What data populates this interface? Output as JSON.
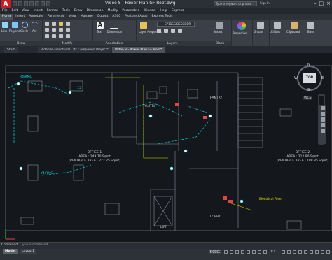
{
  "app": {
    "logo": "A",
    "title": "Video 8 - Power Plan GF Roof.dwg",
    "search_placeholder": "Type a keyword or phrase",
    "sign_in": "Sign In",
    "window_controls": [
      "–",
      "□",
      "×"
    ]
  },
  "menu": [
    "File",
    "Edit",
    "View",
    "Insert",
    "Format",
    "Tools",
    "Draw",
    "Dimension",
    "Modify",
    "Parametric",
    "Window",
    "Help",
    "Express"
  ],
  "ribbon_tabs": [
    "Home",
    "Insert",
    "Annotate",
    "Parametric",
    "View",
    "Manage",
    "Output",
    "A360",
    "Featured Apps",
    "Express Tools"
  ],
  "ribbon": {
    "draw": {
      "title": "Draw",
      "tools": [
        "Line",
        "Polyline",
        "Circle",
        "Arc"
      ]
    },
    "modify": {
      "title": "Modify"
    },
    "annotation": {
      "title": "Annotation",
      "tools": [
        "Text",
        "Dimension"
      ]
    },
    "layers": {
      "title": "Layers",
      "tools": [
        "Layer Properties"
      ],
      "current_layer": "CP11SGIDESGDDR"
    },
    "block": {
      "title": "Block",
      "tools": [
        "Insert"
      ]
    },
    "properties": {
      "tools": [
        "Properties"
      ]
    },
    "groups": {
      "tools": [
        "Groups"
      ]
    },
    "utilities": {
      "tools": [
        "Utilities"
      ]
    },
    "clipboard": {
      "tools": [
        "Clipboard"
      ]
    },
    "view": {
      "tools": [
        "Base"
      ]
    }
  },
  "file_tabs": [
    {
      "label": "Start"
    },
    {
      "label": "Video 8 - Electrical...Its Compound Project*"
    },
    {
      "label": "Video 8 - Power Plan GF Roof*"
    }
  ],
  "viewcube": {
    "top": "TOP",
    "n": "N",
    "s": "S",
    "e": "E",
    "w": "W",
    "wcs": "WCS"
  },
  "drawing_labels": {
    "office1": [
      "OFFICE-1",
      "AREA : 249.70 Sqmt",
      "(RENTABLE AREA : 222.25 Sqmt)"
    ],
    "office2": [
      "OFFICE-2",
      "AREA : 212.90 Sqmt",
      "(RENTABLE AREA : 188.85 Sqmt)"
    ],
    "pantry1": "PANTRY",
    "pantry2": "PANTRY",
    "lift": "LIFT",
    "lobby": "LOBBY",
    "rmc1": "R4/RMC",
    "rmc2": "Y4/RMC",
    "riser": "Electrical Riser",
    "ref": "15"
  },
  "command": {
    "label": "Command:",
    "placeholder": "Type a command"
  },
  "layouts": [
    "Model",
    "Layout1"
  ],
  "status": {
    "model": "MODEL",
    "scale": "1:1"
  },
  "colors": {
    "canvas": "#14171c",
    "circuit": "#00c8d2",
    "accent": "#c21f26"
  }
}
